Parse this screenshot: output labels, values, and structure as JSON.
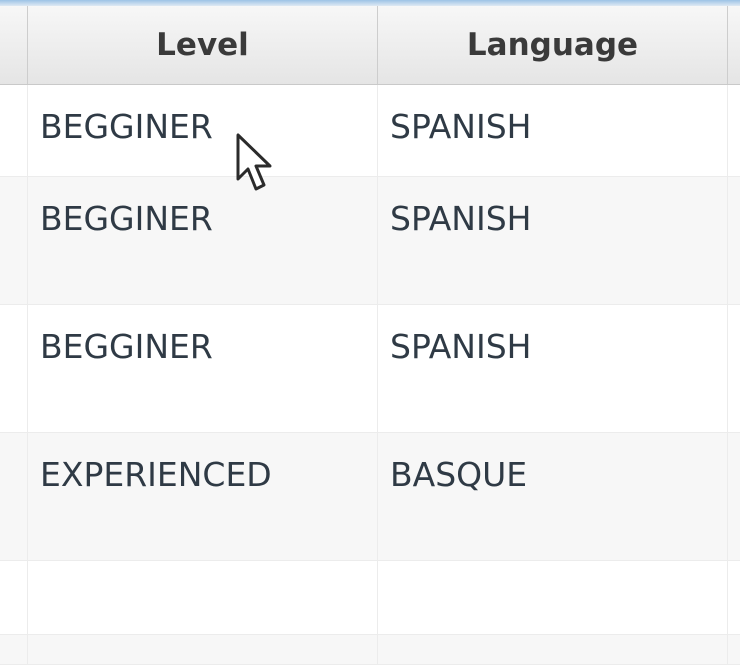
{
  "table": {
    "columns": [
      "Level",
      "Language"
    ],
    "rows": [
      [
        "BEGGINER",
        "SPANISH"
      ],
      [
        "BEGGINER",
        "SPANISH"
      ],
      [
        "BEGGINER",
        "SPANISH"
      ],
      [
        "EXPERIENCED",
        "BASQUE"
      ],
      [
        "",
        ""
      ],
      [
        "",
        ""
      ]
    ]
  },
  "cursor": {
    "icon": "mouse-pointer-icon"
  }
}
